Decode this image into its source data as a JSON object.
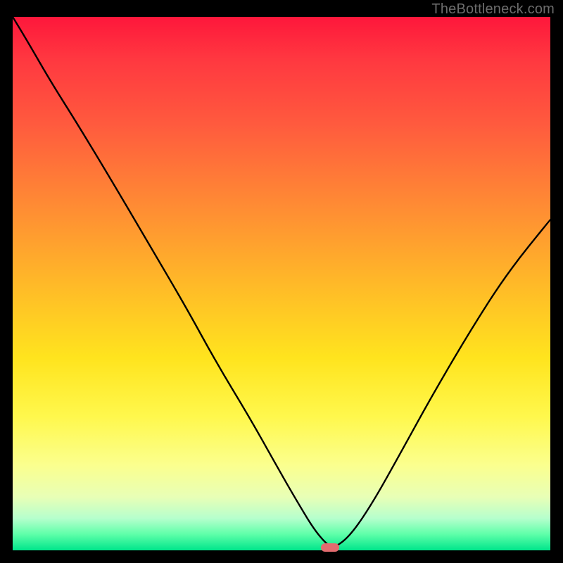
{
  "watermark": "TheBottleneck.com",
  "chart_data": {
    "type": "line",
    "title": "",
    "xlabel": "",
    "ylabel": "",
    "xlim": [
      0,
      100
    ],
    "ylim": [
      0,
      100
    ],
    "grid": false,
    "legend": false,
    "series": [
      {
        "name": "bottleneck-curve",
        "x": [
          0,
          3,
          7,
          12,
          18,
          25,
          32,
          38,
          44,
          49,
          53,
          56,
          58.5,
          60,
          63,
          67,
          72,
          78,
          85,
          92,
          100
        ],
        "y": [
          100,
          95,
          88,
          80,
          70,
          58,
          46,
          35,
          25,
          16,
          9,
          4,
          1,
          0.5,
          3,
          9,
          18,
          29,
          41,
          52,
          62
        ]
      }
    ],
    "minimum_marker": {
      "x": 59,
      "y": 0.5,
      "color": "#e26b6f"
    },
    "gradient_stops": [
      {
        "pos": 0.0,
        "color": "#fe173b"
      },
      {
        "pos": 0.35,
        "color": "#ff8a34"
      },
      {
        "pos": 0.64,
        "color": "#ffe41e"
      },
      {
        "pos": 0.9,
        "color": "#e8ffb6"
      },
      {
        "pos": 1.0,
        "color": "#00e58b"
      }
    ]
  }
}
